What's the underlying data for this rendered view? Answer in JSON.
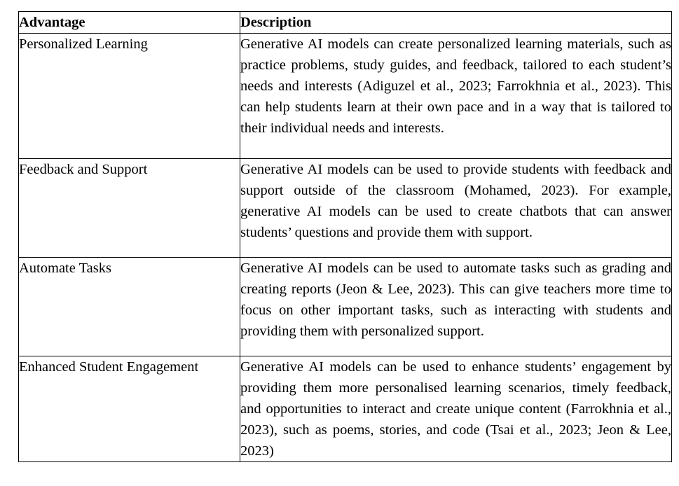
{
  "table": {
    "columns": [
      {
        "key": "advantage",
        "header": "Advantage"
      },
      {
        "key": "description",
        "header": "Description"
      }
    ],
    "rows": [
      {
        "advantage": "Personalized Learning",
        "description": "Generative AI models can create personalized learning materials, such as practice problems, study guides, and feedback, tailored to each student’s needs and interests (Adiguzel et al., 2023; Farrokhnia et al., 2023).  This can help students learn at their own pace and in a way that is tailored to their individual needs and interests."
      },
      {
        "advantage": "Feedback and Support",
        "description": "Generative AI models can be used to provide students with feedback and support outside of the classroom (Mohamed, 2023).  For example, generative AI models can be used to create chatbots that can answer students’ questions and provide them with support."
      },
      {
        "advantage": "Automate Tasks",
        "description": "Generative AI models can be used to automate tasks such as grading and creating reports (Jeon & Lee, 2023).  This can give teachers more time to focus on other important tasks, such as interacting with students and providing them with personalized support."
      },
      {
        "advantage": "Enhanced Student Engage­ment",
        "description": "Generative AI models can be used to enhance students’ engagement by providing them more personalised learning scenarios, timely feedback, and opportunities to interact and create unique content (Farrokhnia et al., 2023), such as poems, stories, and code (Tsai et al., 2023; Jeon & Lee, 2023)"
      }
    ]
  },
  "style": {
    "border_color": "#000000",
    "text_color": "#000000",
    "background": "#ffffff"
  }
}
